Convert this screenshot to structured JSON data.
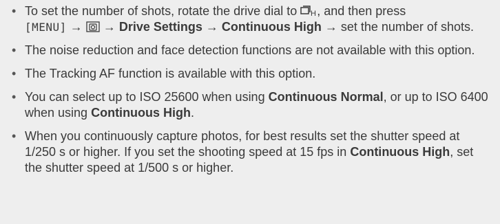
{
  "icons": {
    "drive_high": "continuous-high-drive-icon",
    "camera_menu": "camera-shooting-menu-icon"
  },
  "notes": [
    {
      "p1": "To set the number of shots, rotate the drive dial to ",
      "p2": ", and then press",
      "menu_key": "[MENU]",
      "arrow1": " → ",
      "arrow2": " → ",
      "drive_settings": "Drive Settings",
      "arrow3": " → ",
      "continuous_high": "Continuous High",
      "p3": " → set the number of shots."
    },
    {
      "text": "The noise reduction and face detection functions are not available with this option."
    },
    {
      "text": "The Tracking AF function is available with this option."
    },
    {
      "p1": "You can select up to ISO 25600 when using ",
      "continuous_normal": "Continuous Normal",
      "p2": ", or up to ISO 6400 when using ",
      "continuous_high": "Continuous High",
      "p3": "."
    },
    {
      "p1": "When you continuously capture photos, for best results set the shutter speed at 1/250 s or higher. If you set the shooting speed at 15 fps in ",
      "continuous": "Continuous High",
      "p2": ", set the shutter speed at 1/500 s or higher."
    }
  ]
}
